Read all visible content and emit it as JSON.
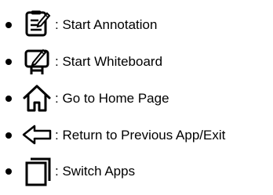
{
  "legend": {
    "items": [
      {
        "icon": "annotation-icon",
        "separator": ":",
        "label": "Start Annotation"
      },
      {
        "icon": "whiteboard-icon",
        "separator": ":",
        "label": "Start Whiteboard"
      },
      {
        "icon": "home-icon",
        "separator": ":",
        "label": "Go to Home Page"
      },
      {
        "icon": "back-arrow-icon",
        "separator": ":",
        "label": "Return to Previous App/Exit"
      },
      {
        "icon": "switch-apps-icon",
        "separator": ":",
        "label": "Switch Apps"
      }
    ]
  }
}
